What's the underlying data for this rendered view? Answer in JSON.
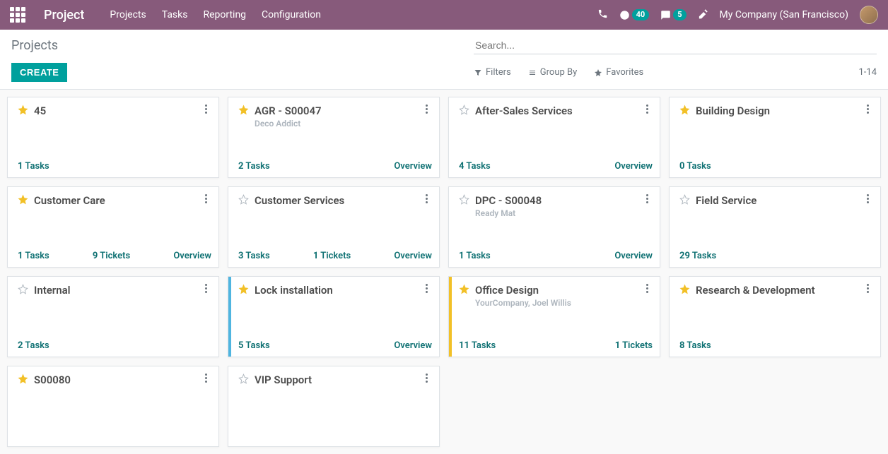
{
  "navbar": {
    "brand": "Project",
    "links": [
      "Projects",
      "Tasks",
      "Reporting",
      "Configuration"
    ],
    "activity_count": "40",
    "message_count": "5",
    "company": "My Company (San Francisco)"
  },
  "control": {
    "breadcrumb": "Projects",
    "search_placeholder": "Search...",
    "create_label": "CREATE",
    "filters_label": "Filters",
    "groupby_label": "Group By",
    "favorites_label": "Favorites",
    "pager": "1-14"
  },
  "cards": [
    {
      "starred": true,
      "title": "45",
      "sub": "",
      "tasks": "1",
      "tickets": "",
      "overview": "",
      "bar": ""
    },
    {
      "starred": true,
      "title": "AGR - S00047",
      "sub": "Deco Addict",
      "tasks": "2",
      "tickets": "",
      "overview": "Overview",
      "bar": ""
    },
    {
      "starred": false,
      "title": "After-Sales Services",
      "sub": "",
      "tasks": "4",
      "tickets": "",
      "overview": "Overview",
      "bar": ""
    },
    {
      "starred": true,
      "title": "Building Design",
      "sub": "",
      "tasks": "0",
      "tickets": "",
      "overview": "",
      "bar": ""
    },
    {
      "starred": true,
      "title": "Customer Care",
      "sub": "",
      "tasks": "1",
      "tickets": "9",
      "overview": "Overview",
      "bar": ""
    },
    {
      "starred": false,
      "title": "Customer Services",
      "sub": "",
      "tasks": "3",
      "tickets": "1",
      "overview": "Overview",
      "bar": ""
    },
    {
      "starred": false,
      "title": "DPC - S00048",
      "sub": "Ready Mat",
      "tasks": "1",
      "tickets": "",
      "overview": "Overview",
      "bar": ""
    },
    {
      "starred": false,
      "title": "Field Service",
      "sub": "",
      "tasks": "29",
      "tickets": "",
      "overview": "",
      "bar": ""
    },
    {
      "starred": false,
      "title": "Internal",
      "sub": "",
      "tasks": "2",
      "tickets": "",
      "overview": "",
      "bar": ""
    },
    {
      "starred": true,
      "title": "Lock installation",
      "sub": "",
      "tasks": "5",
      "tickets": "",
      "overview": "Overview",
      "bar": "blue"
    },
    {
      "starred": true,
      "title": "Office Design",
      "sub": "YourCompany, Joel Willis",
      "tasks": "11",
      "tickets": "1",
      "overview": "",
      "bar": "yellow"
    },
    {
      "starred": true,
      "title": "Research & Development",
      "sub": "",
      "tasks": "8",
      "tickets": "",
      "overview": "",
      "bar": ""
    },
    {
      "starred": true,
      "title": "S00080",
      "sub": "",
      "tasks": "",
      "tickets": "",
      "overview": "",
      "bar": ""
    },
    {
      "starred": false,
      "title": "VIP Support",
      "sub": "",
      "tasks": "",
      "tickets": "",
      "overview": "",
      "bar": ""
    }
  ],
  "labels": {
    "tasks_suffix": " Tasks",
    "tickets_suffix": " Tickets"
  }
}
